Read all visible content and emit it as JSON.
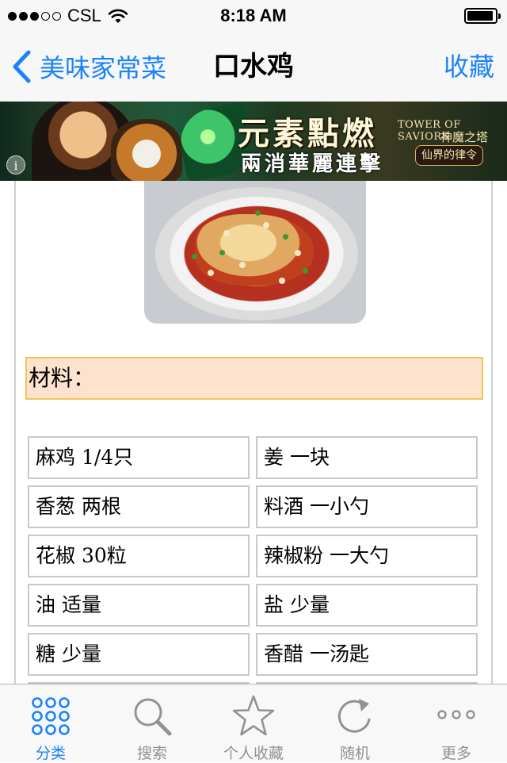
{
  "status_bar": {
    "carrier": "CSL",
    "time": "8:18 AM",
    "signal_bars_filled": 3,
    "signal_bars_total": 5,
    "battery_level": 0.95
  },
  "nav": {
    "back_label": "美味家常菜",
    "title": "口水鸡",
    "favorite_label": "收藏"
  },
  "banner": {
    "title": "元素點燃",
    "subtitle": "兩消華麗連擊",
    "brand": "TOWER OF SAVIORS",
    "brand_cn": "神魔之塔",
    "tagline": "仙界的律令",
    "info_label": "i"
  },
  "recipe": {
    "materials_label": "材料："
  },
  "ingredients": [
    "麻鸡 1/4只",
    "姜 一块",
    "香葱 两根",
    "料酒 一小勺",
    "花椒 30粒",
    "辣椒粉 一大勺",
    "油 适量",
    "盐 少量",
    "糖 少量",
    "香醋 一汤匙"
  ],
  "tab_bar": {
    "tabs": [
      {
        "label": "分类",
        "icon": "grid-icon",
        "active": true
      },
      {
        "label": "搜索",
        "icon": "search-icon",
        "active": false
      },
      {
        "label": "个人收藏",
        "icon": "star-icon",
        "active": false
      },
      {
        "label": "随机",
        "icon": "refresh-icon",
        "active": false
      },
      {
        "label": "更多",
        "icon": "more-icon",
        "active": false
      }
    ]
  },
  "colors": {
    "accent": "#1a82fb",
    "materials_bg": "#fde3cd",
    "materials_border": "#f2c45a",
    "tab_inactive": "#929292"
  }
}
